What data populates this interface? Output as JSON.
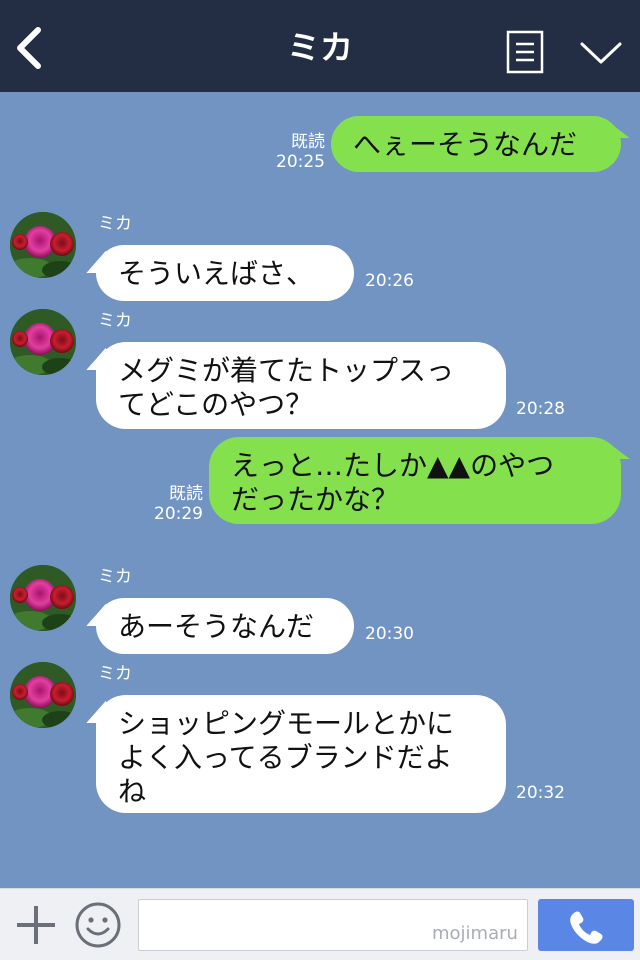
{
  "header": {
    "title": "ミカ",
    "back_icon": "chevron-left-icon",
    "menu_icon": "list-menu-icon",
    "collapse_icon": "chevron-down-icon"
  },
  "messages": [
    {
      "direction": "out",
      "read_label": "既読",
      "time": "20:25",
      "text": "へぇーそうなんだ"
    },
    {
      "direction": "in",
      "sender": "ミカ",
      "time": "20:26",
      "text": "そういえばさ、"
    },
    {
      "direction": "in",
      "sender": "ミカ",
      "time": "20:28",
      "text": "メグミが着てたトップスっ\nてどこのやつ？"
    },
    {
      "direction": "out",
      "read_label": "既読",
      "time": "20:29",
      "text": "えっと…たしか▲▲のやつ\nだったかな？"
    },
    {
      "direction": "in",
      "sender": "ミカ",
      "time": "20:30",
      "text": "あーそうなんだ"
    },
    {
      "direction": "in",
      "sender": "ミカ",
      "time": "20:32",
      "text": "ショッピングモールとかに\nよく入ってるブランドだよ\nね"
    }
  ],
  "footer": {
    "plus_icon": "plus-icon",
    "emoji_icon": "smiley-icon",
    "input_value": "",
    "watermark": "mojimaru",
    "call_icon": "phone-icon"
  },
  "colors": {
    "header_bg": "#232d44",
    "chat_bg": "#7294c3",
    "outgoing_bubble": "#84e04c",
    "incoming_bubble": "#ffffff",
    "call_button": "#5a86e6"
  }
}
